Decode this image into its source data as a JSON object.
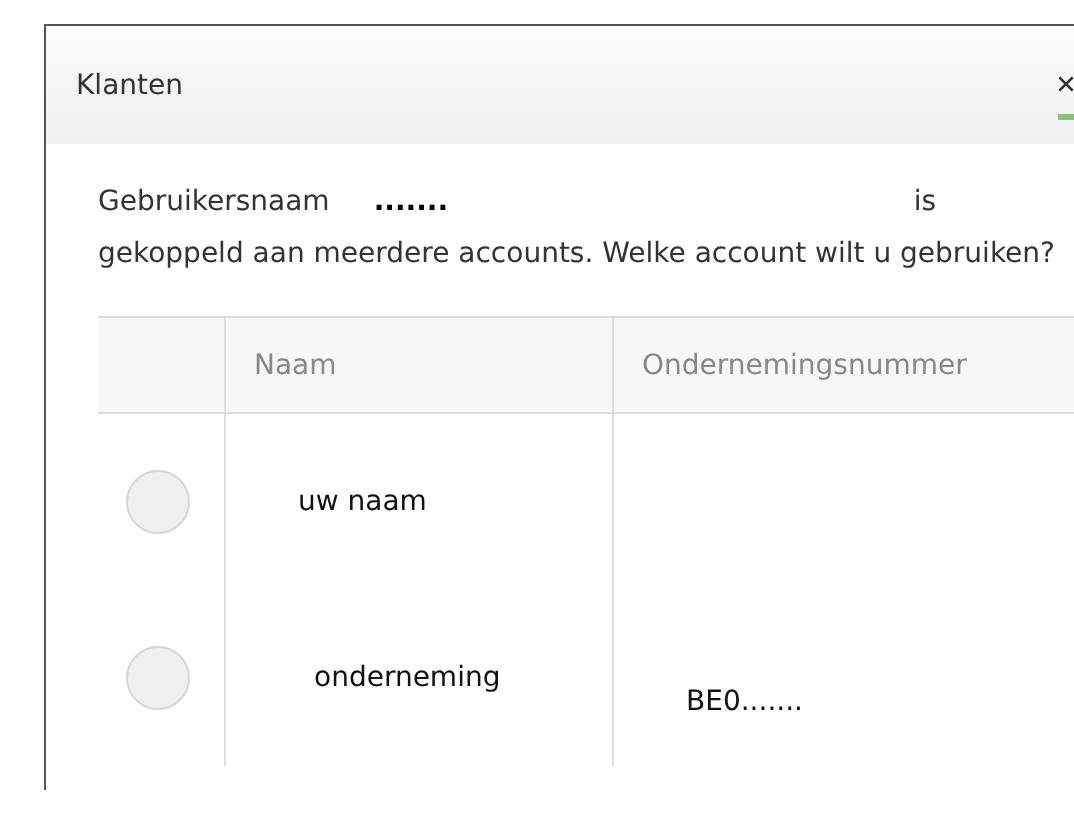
{
  "dialog": {
    "title": "Klanten"
  },
  "message": {
    "label": "Gebruikersnaam",
    "username": ".......",
    "suffix": "is",
    "text": "gekoppeld aan meerdere accounts. Welke account wilt u gebruiken?"
  },
  "table": {
    "columns": [
      "Naam",
      "Ondernemingsnummer"
    ],
    "rows": [
      {
        "selected": false,
        "name": "uw naam",
        "number": ""
      },
      {
        "selected": false,
        "name": "onderneming",
        "number": "BE0......."
      }
    ]
  }
}
